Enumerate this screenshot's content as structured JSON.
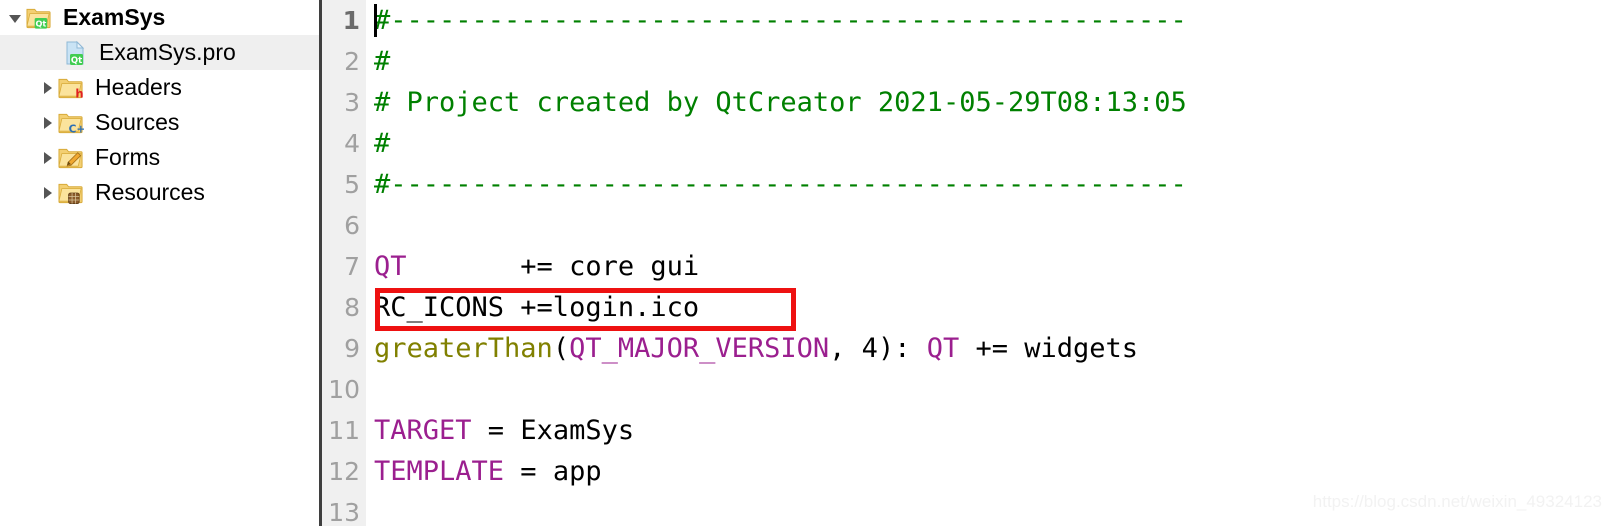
{
  "sidebar": {
    "items": [
      {
        "label": "ExamSys",
        "icon": "folder-qt-icon",
        "twisty": "chevron-down-icon",
        "depth": 0,
        "bold": true,
        "selected": false
      },
      {
        "label": "ExamSys.pro",
        "icon": "file-qt-pro-icon",
        "twisty": "none",
        "depth": 1,
        "bold": false,
        "selected": true
      },
      {
        "label": "Headers",
        "icon": "folder-headers-icon",
        "twisty": "chevron-right-icon",
        "depth": 1,
        "bold": false,
        "selected": false
      },
      {
        "label": "Sources",
        "icon": "folder-sources-icon",
        "twisty": "chevron-right-icon",
        "depth": 1,
        "bold": false,
        "selected": false
      },
      {
        "label": "Forms",
        "icon": "folder-forms-icon",
        "twisty": "chevron-right-icon",
        "depth": 1,
        "bold": false,
        "selected": false
      },
      {
        "label": "Resources",
        "icon": "folder-resources-icon",
        "twisty": "chevron-right-icon",
        "depth": 1,
        "bold": false,
        "selected": false
      }
    ]
  },
  "editor": {
    "current_line": 1,
    "caret_line": 1,
    "lines": [
      {
        "no": "1",
        "tokens": [
          {
            "t": "#-------------------------------------------------",
            "c": "comment"
          }
        ]
      },
      {
        "no": "2",
        "tokens": [
          {
            "t": "#",
            "c": "comment"
          }
        ]
      },
      {
        "no": "3",
        "tokens": [
          {
            "t": "# Project created by QtCreator 2021-05-29T08:13:05",
            "c": "comment"
          }
        ]
      },
      {
        "no": "4",
        "tokens": [
          {
            "t": "#",
            "c": "comment"
          }
        ]
      },
      {
        "no": "5",
        "tokens": [
          {
            "t": "#-------------------------------------------------",
            "c": "comment"
          }
        ]
      },
      {
        "no": "6",
        "tokens": []
      },
      {
        "no": "7",
        "tokens": [
          {
            "t": "QT",
            "c": "var"
          },
          {
            "t": "       += core gui",
            "c": "plain"
          }
        ]
      },
      {
        "no": "8",
        "tokens": [
          {
            "t": "RC_ICONS +=login.ico",
            "c": "plain"
          }
        ]
      },
      {
        "no": "9",
        "tokens": [
          {
            "t": "greaterThan",
            "c": "func"
          },
          {
            "t": "(",
            "c": "plain"
          },
          {
            "t": "QT_MAJOR_VERSION",
            "c": "var"
          },
          {
            "t": ", 4): ",
            "c": "plain"
          },
          {
            "t": "QT",
            "c": "var"
          },
          {
            "t": " += widgets",
            "c": "plain"
          }
        ]
      },
      {
        "no": "10",
        "tokens": []
      },
      {
        "no": "11",
        "tokens": [
          {
            "t": "TARGET",
            "c": "var"
          },
          {
            "t": " = ExamSys",
            "c": "plain"
          }
        ]
      },
      {
        "no": "12",
        "tokens": [
          {
            "t": "TEMPLATE",
            "c": "var"
          },
          {
            "t": " = app",
            "c": "plain"
          }
        ]
      },
      {
        "no": "13",
        "tokens": []
      }
    ],
    "highlight_box": {
      "label": "rc-icons-highlight",
      "color": "#ee1111",
      "target_line": "8"
    }
  },
  "colors": {
    "comment": "#008000",
    "variable": "#9b1f8f",
    "function": "#808000",
    "plain": "#000000",
    "gutter_bg": "#f0f0f0",
    "selection_bg": "#efefef",
    "annotation_red": "#ee1111"
  },
  "watermark": {
    "text": "https://blog.csdn.net/weixin_49324123"
  }
}
